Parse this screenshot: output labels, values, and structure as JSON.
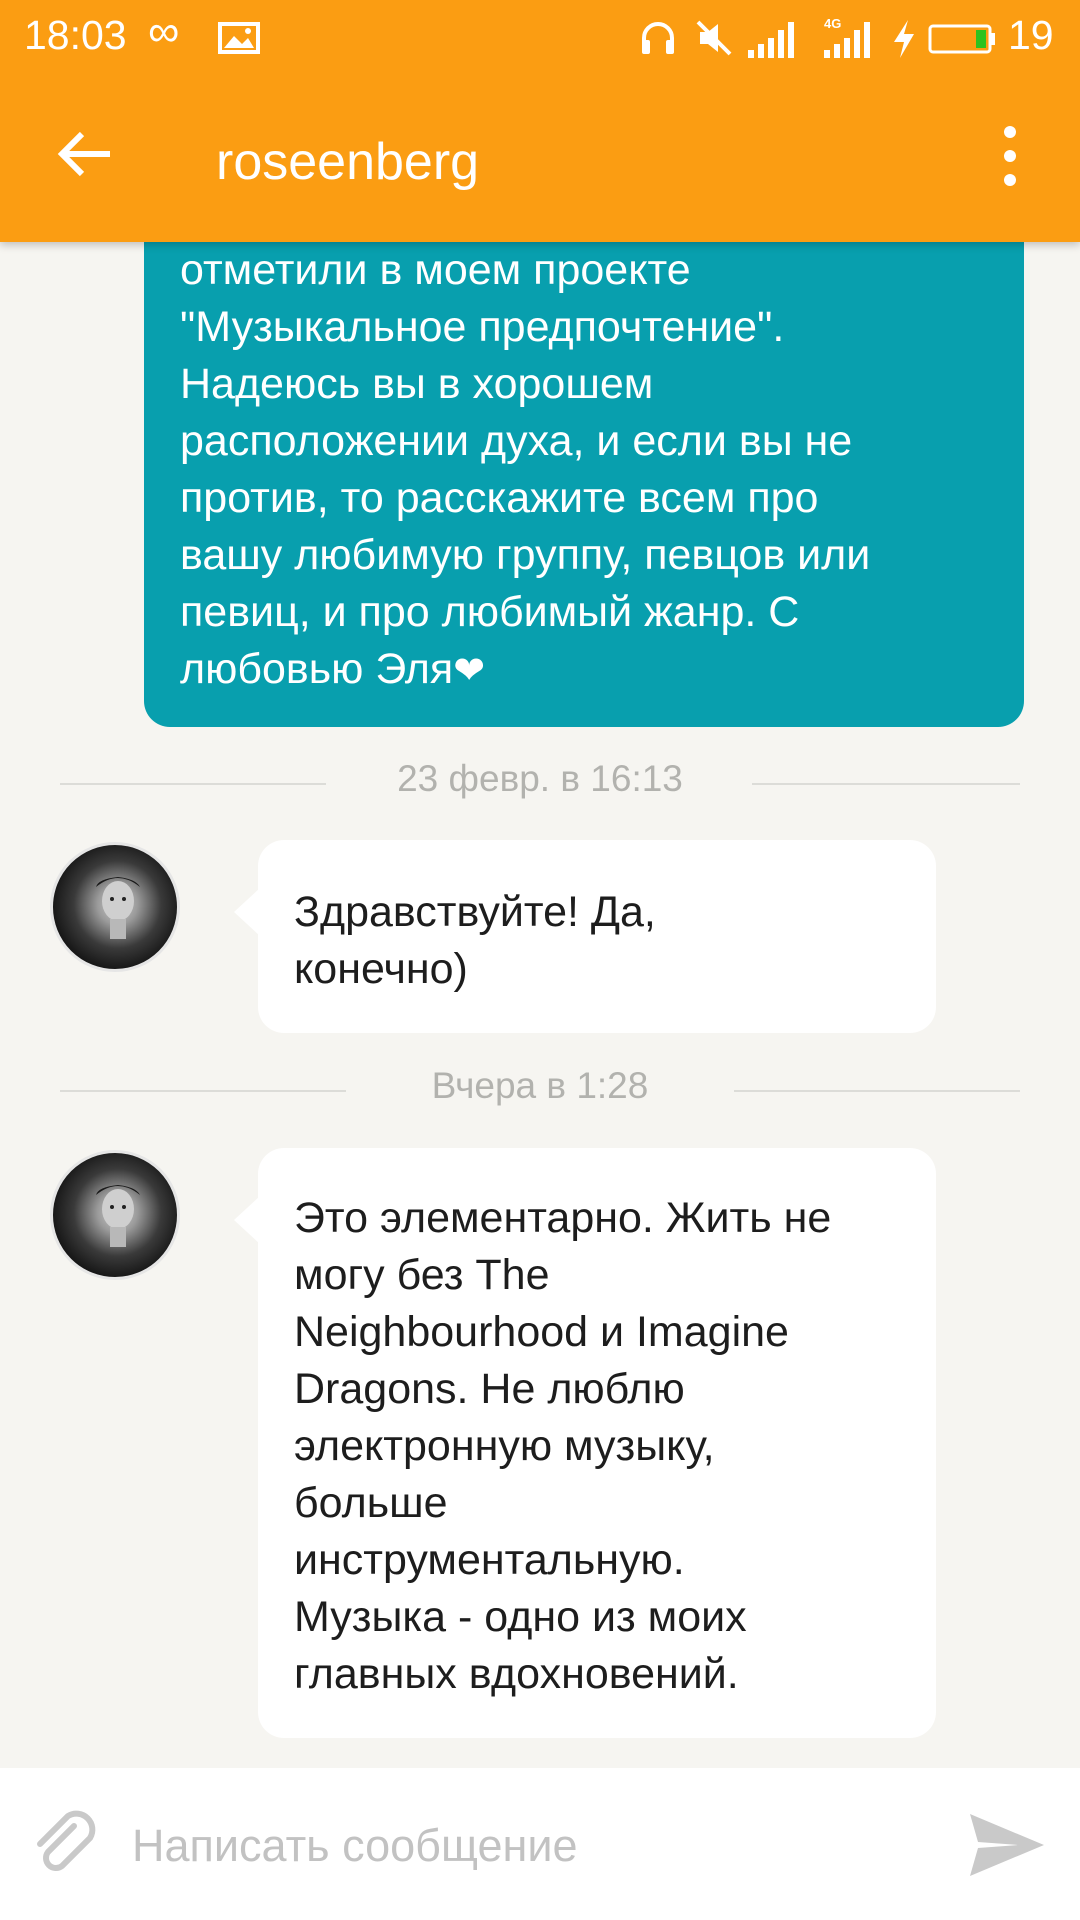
{
  "status_bar": {
    "time": "18:03",
    "battery": "19",
    "network": "4G",
    "icons": [
      "infinity-icon",
      "gallery-icon",
      "headphones-icon",
      "mute-icon",
      "signal-icon",
      "charging-bolt-icon",
      "battery-icon"
    ]
  },
  "toolbar": {
    "title": "roseenberg",
    "back_icon": "arrow-left-icon",
    "menu_icon": "more-vertical-icon"
  },
  "messages": {
    "outgoing": {
      "lines": [
        "отметили в моем проекте",
        "\"Музыкальное предпочтение\".",
        "Надеюсь вы в хорошем",
        "расположении духа, и если вы не",
        "против, то расскажите всем про",
        "вашу любимую группу, певцов или",
        "певиц, и про любимый жанр. С",
        "любовью Эля"
      ],
      "emoji": "❤"
    },
    "separator_1": "23 февр. в 16:13",
    "incoming_1": {
      "lines": [
        "Здравствуйте! Да,",
        "конечно)"
      ]
    },
    "separator_2": "Вчера в 1:28",
    "incoming_2": {
      "lines": [
        "Это элементарно. Жить не",
        "могу без The",
        "Neighbourhood и Imagine",
        "Dragons. Не люблю",
        "электронную музыку,",
        "больше",
        "инструментальную.",
        "Музыка - одно из моих",
        "главных вдохновений."
      ]
    }
  },
  "compose": {
    "placeholder": "Написать сообщение",
    "value": "",
    "attach_icon": "paperclip-icon",
    "send_icon": "send-icon"
  },
  "colors": {
    "header": "#fb9d12",
    "outgoing_bubble": "#089fae",
    "incoming_bubble": "#ffffff",
    "background": "#f6f5f1",
    "timestamp": "#b2b2ae"
  }
}
